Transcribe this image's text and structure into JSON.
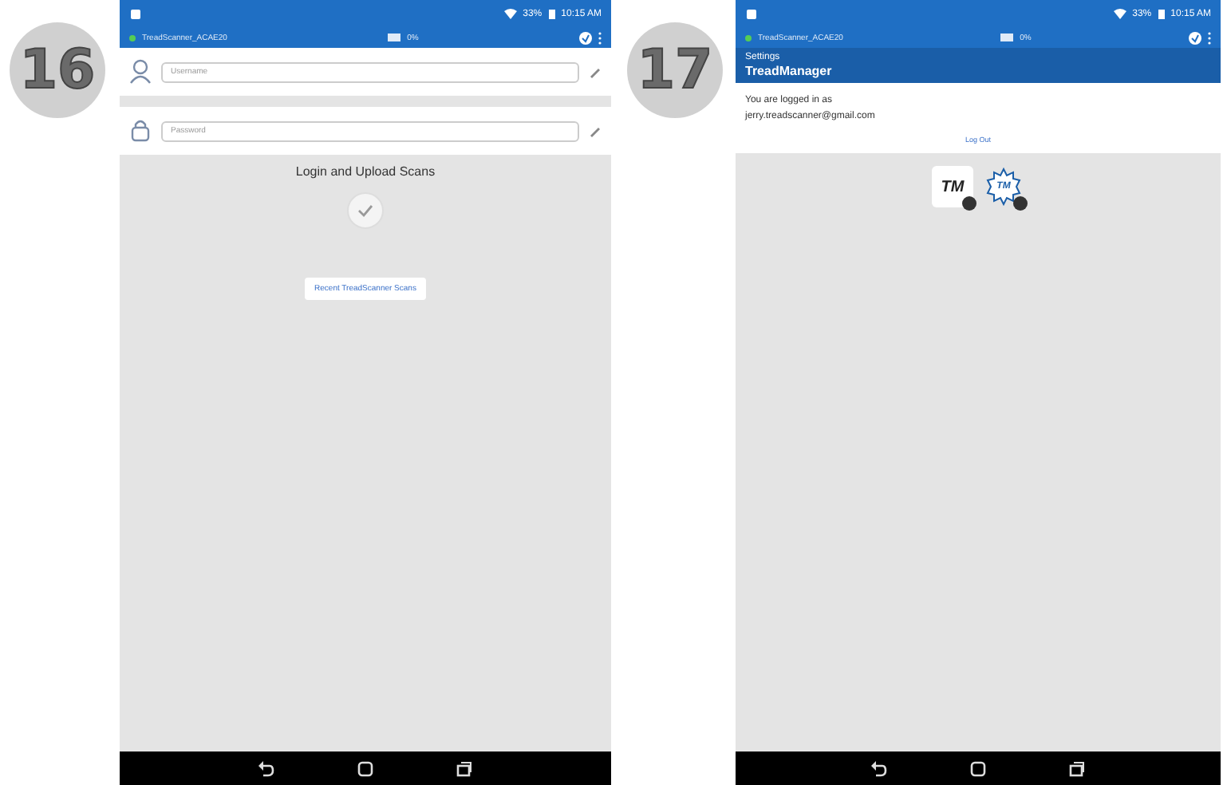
{
  "steps": [
    {
      "number": "16",
      "screen": {
        "kind": "login",
        "status": {
          "battery": "33%",
          "time": "10:15 AM"
        },
        "device_bar": {
          "device": "TreadScanner_ACAE20",
          "signal": "0%"
        },
        "fields": [
          {
            "kind": "user",
            "placeholder": "Username"
          },
          {
            "kind": "lock",
            "placeholder": "Password"
          }
        ],
        "heading": "Login and Upload Scans",
        "button": "Recent TreadScanner Scans"
      }
    },
    {
      "number": "17",
      "screen": {
        "kind": "settings",
        "status": {
          "battery": "33%",
          "time": "10:15 AM"
        },
        "device_bar": {
          "device": "TreadScanner_ACAE20",
          "signal": "0%"
        },
        "title_bar": {
          "subtitle": "Settings",
          "title": "TreadManager"
        },
        "account": {
          "label": "You are logged in as",
          "email": "jerry.treadscanner@gmail.com",
          "link": "Log Out"
        },
        "apps": [
          {
            "kind": "logo",
            "text": "TM"
          },
          {
            "kind": "gear",
            "text": "TM"
          }
        ]
      }
    }
  ]
}
